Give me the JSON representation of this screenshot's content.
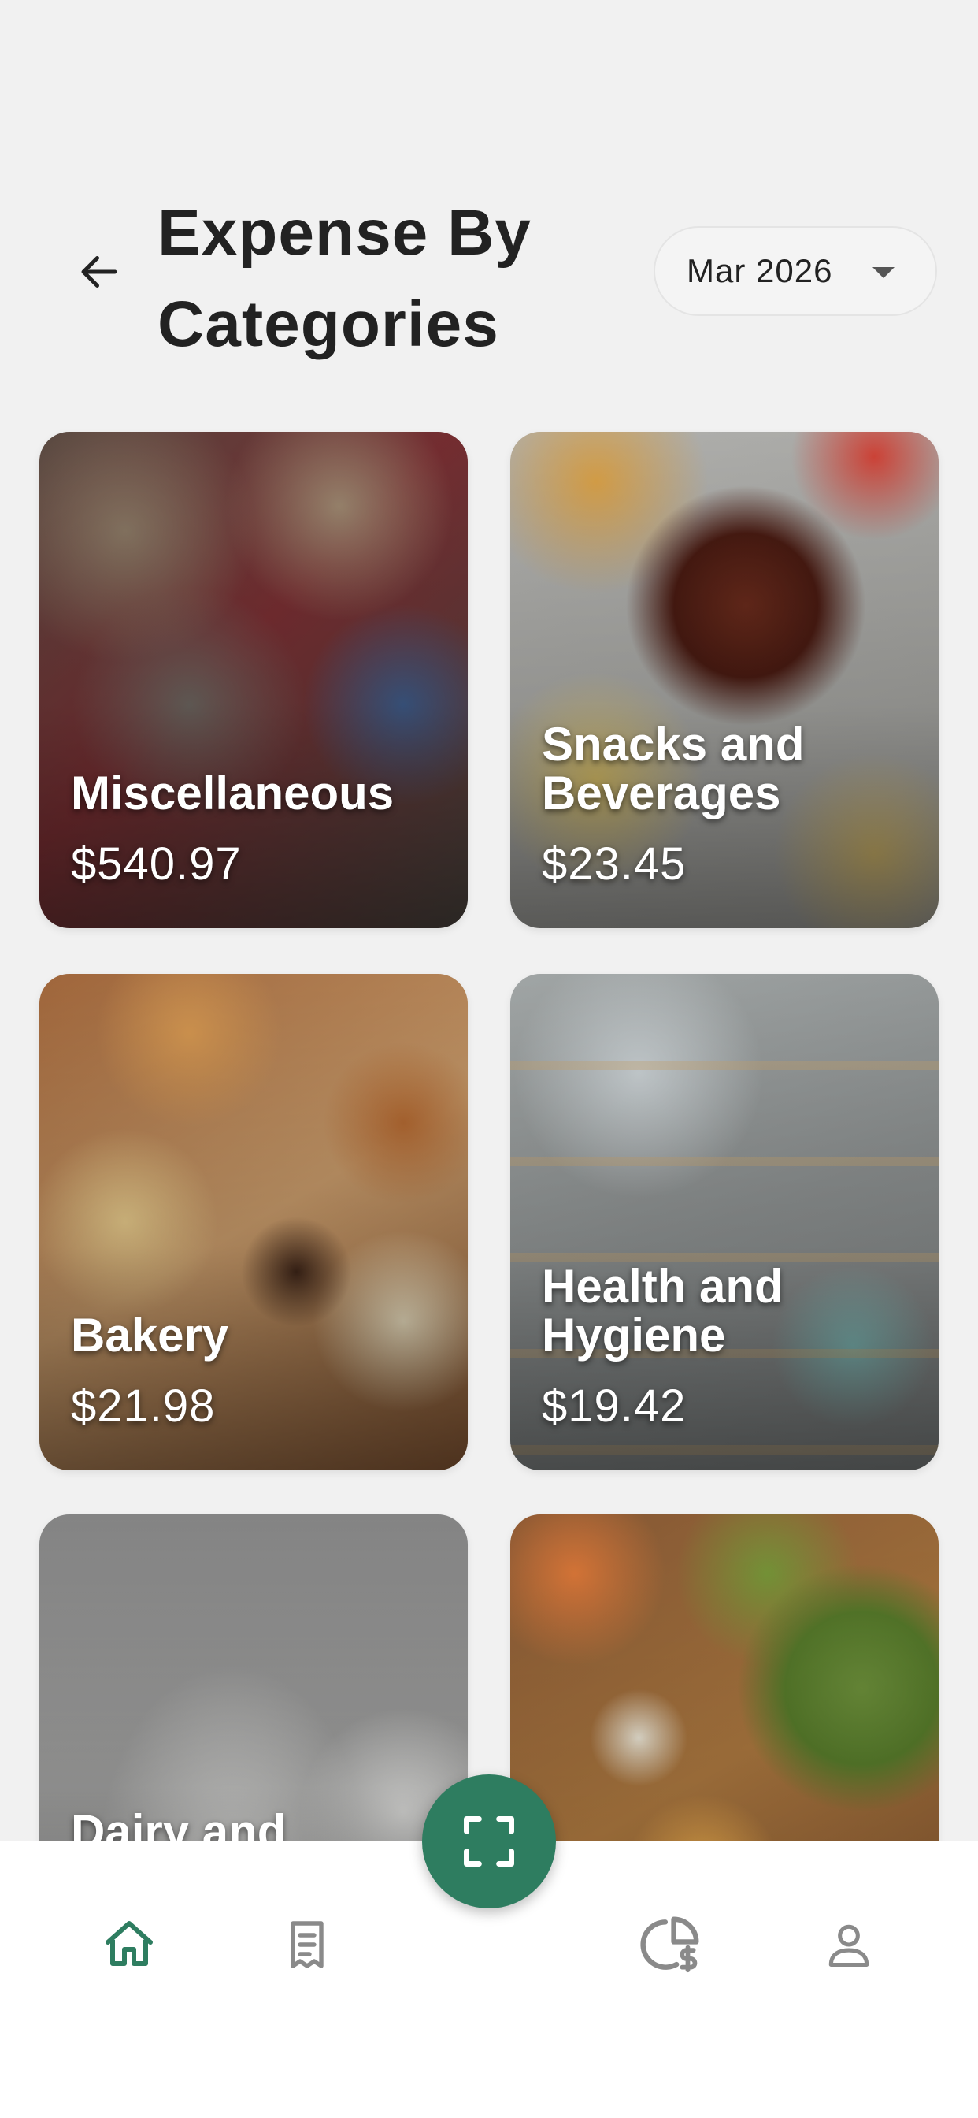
{
  "header": {
    "title": "Expense By Categories",
    "month": "Mar 2026"
  },
  "categories": [
    {
      "name": "Miscellaneous",
      "amount": "$540.97"
    },
    {
      "name": "Snacks and Beverages",
      "amount": "$23.45"
    },
    {
      "name": "Bakery",
      "amount": "$21.98"
    },
    {
      "name": "Health and Hygiene",
      "amount": "$19.42"
    },
    {
      "name": "Dairy and",
      "amount": ""
    },
    {
      "name": "",
      "amount": ""
    }
  ],
  "bottom_nav": {
    "items": [
      {
        "icon": "home-icon",
        "active": true
      },
      {
        "icon": "receipt-icon",
        "active": false
      },
      {
        "icon": "scan-icon",
        "active": false
      },
      {
        "icon": "pie-chart-dollar-icon",
        "active": false
      },
      {
        "icon": "profile-icon",
        "active": false
      }
    ]
  },
  "colors": {
    "accent": "#2e7d60",
    "background": "#f1f1f1",
    "inactive_icon": "#8a8a8a"
  }
}
